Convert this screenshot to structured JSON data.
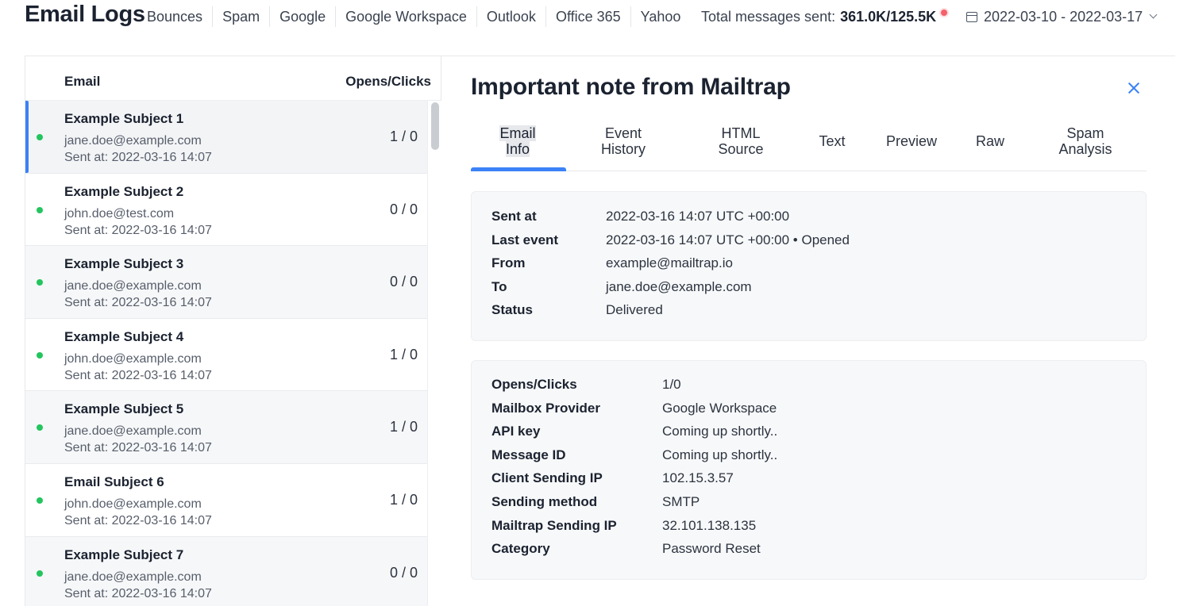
{
  "header": {
    "title": "Email Logs",
    "filters": [
      "Bounces",
      "Spam",
      "Google",
      "Google Workspace",
      "Outlook",
      "Office 365",
      "Yahoo"
    ],
    "total_label": "Total messages sent:",
    "total_value": "361.0K/125.5K",
    "date_range": "2022-03-10 - 2022-03-17"
  },
  "list": {
    "col_email": "Email",
    "col_opens_clicks": "Opens/Clicks",
    "rows": [
      {
        "subject": "Example Subject 1",
        "email": "jane.doe@example.com",
        "sent": "Sent at: 2022-03-16 14:07",
        "oc": "1 / 0"
      },
      {
        "subject": "Example Subject 2",
        "email": "john.doe@test.com",
        "sent": "Sent at: 2022-03-16 14:07",
        "oc": "0 / 0"
      },
      {
        "subject": "Example Subject 3",
        "email": "jane.doe@example.com",
        "sent": "Sent at: 2022-03-16 14:07",
        "oc": "0 / 0"
      },
      {
        "subject": "Example Subject 4",
        "email": "john.doe@example.com",
        "sent": "Sent at: 2022-03-16 14:07",
        "oc": "1 / 0"
      },
      {
        "subject": "Example Subject 5",
        "email": "jane.doe@example.com",
        "sent": "Sent at: 2022-03-16 14:07",
        "oc": "1 / 0"
      },
      {
        "subject": "Email Subject 6",
        "email": "john.doe@example.com",
        "sent": "Sent at: 2022-03-16 14:07",
        "oc": "1 / 0"
      },
      {
        "subject": "Example Subject 7",
        "email": "jane.doe@example.com",
        "sent": "Sent at: 2022-03-16 14:07",
        "oc": "0 / 0"
      }
    ]
  },
  "detail": {
    "title": "Important note from Mailtrap",
    "tabs": [
      {
        "l1": "Email",
        "l2": "Info"
      },
      {
        "l1": "Event",
        "l2": "History"
      },
      {
        "l1": "HTML",
        "l2": "Source"
      },
      {
        "l1": "Text",
        "l2": ""
      },
      {
        "l1": "Preview",
        "l2": ""
      },
      {
        "l1": "Raw",
        "l2": ""
      },
      {
        "l1": "Spam",
        "l2": "Analysis"
      }
    ],
    "card1": [
      {
        "k": "Sent at",
        "v": "2022-03-16 14:07 UTC +00:00"
      },
      {
        "k": "Last event",
        "v": "2022-03-16 14:07 UTC +00:00 • Opened"
      },
      {
        "k": "From",
        "v": "example@mailtrap.io"
      },
      {
        "k": "To",
        "v": "jane.doe@example.com"
      },
      {
        "k": "Status",
        "v": "Delivered"
      }
    ],
    "card2": [
      {
        "k": "Opens/Clicks",
        "v": "1/0"
      },
      {
        "k": "Mailbox Provider",
        "v": "Google Workspace"
      },
      {
        "k": "API key",
        "v": "Coming up shortly.."
      },
      {
        "k": "Message ID",
        "v": "Coming up shortly.."
      },
      {
        "k": "Client Sending IP",
        "v": "102.15.3.57"
      },
      {
        "k": "Sending method",
        "v": "SMTP"
      },
      {
        "k": "Mailtrap Sending IP",
        "v": "32.101.138.135"
      },
      {
        "k": "Category",
        "v": "Password Reset"
      }
    ]
  },
  "colors": {
    "accent": "#3b82f6",
    "status_dot": "#22c55e",
    "alert_dot": "#f5606a"
  }
}
